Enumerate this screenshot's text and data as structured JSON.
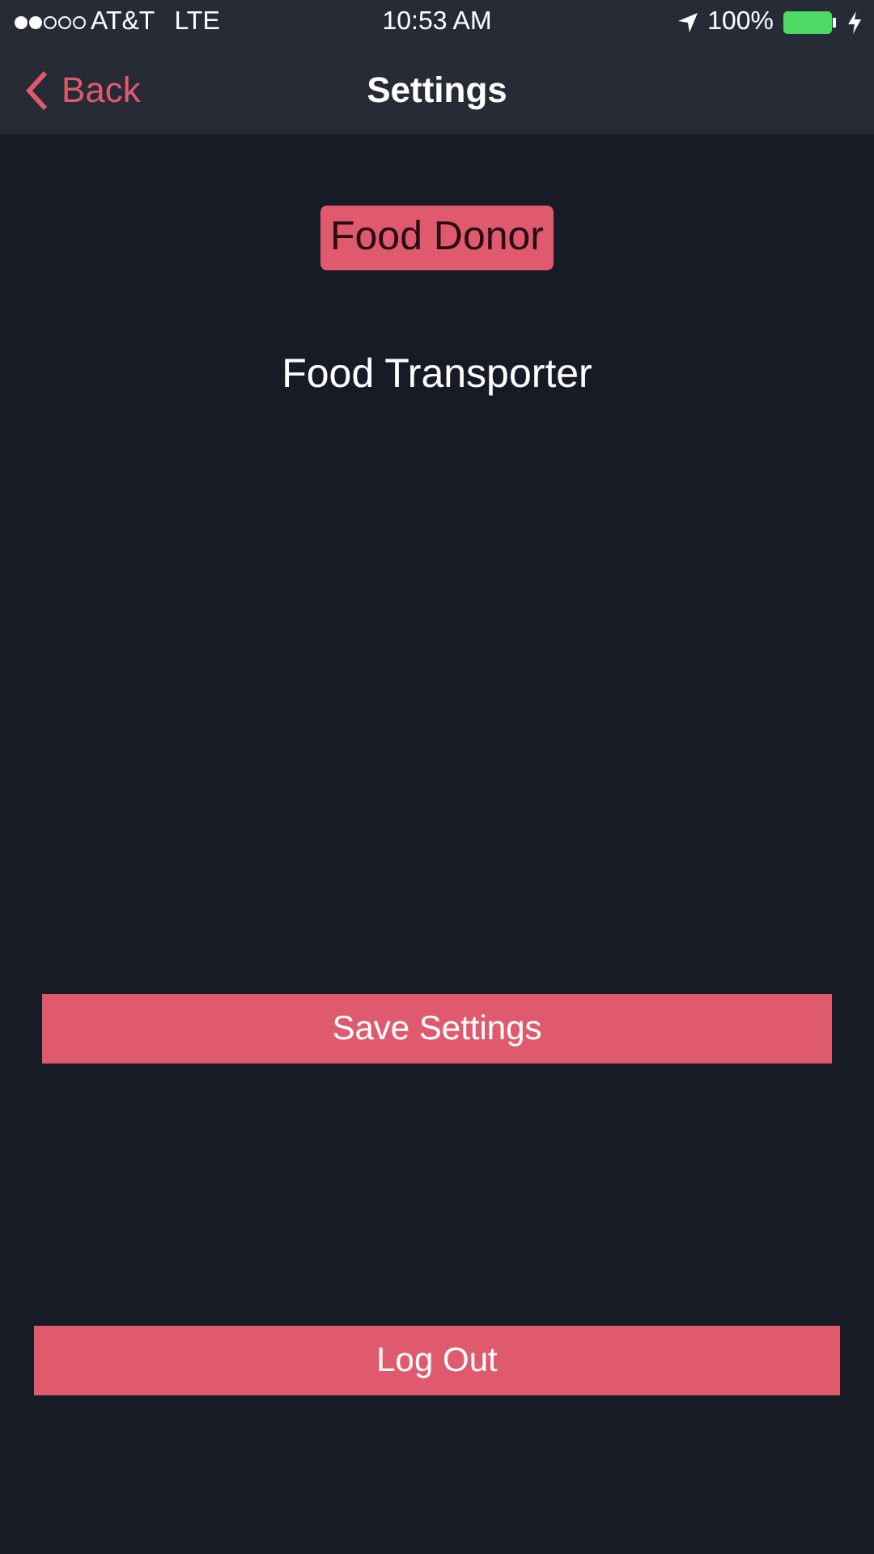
{
  "status_bar": {
    "carrier": "AT&T",
    "network": "LTE",
    "time": "10:53 AM",
    "battery": "100%"
  },
  "nav": {
    "back": "Back",
    "title": "Settings"
  },
  "roles": [
    {
      "label": "Food Donor",
      "selected": true
    },
    {
      "label": "Food Transporter",
      "selected": false
    }
  ],
  "save_button": "Save Settings",
  "logout_button": "Log Out"
}
